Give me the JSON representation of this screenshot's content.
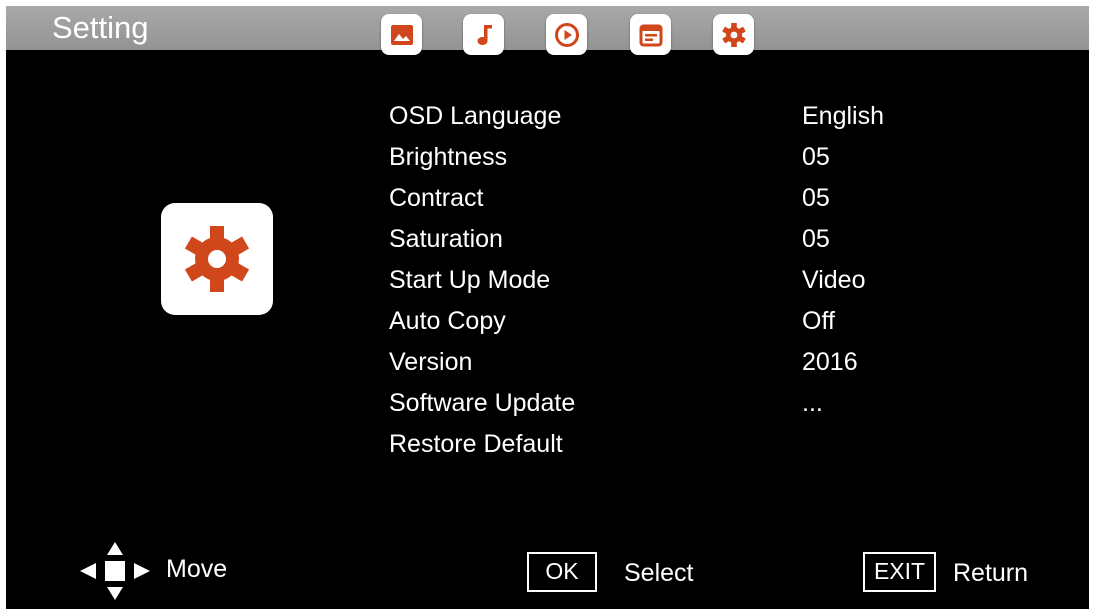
{
  "header": {
    "title": "Setting",
    "tabs": [
      {
        "icon": "photo-icon"
      },
      {
        "icon": "music-note-icon"
      },
      {
        "icon": "play-circle-icon"
      },
      {
        "icon": "calendar-icon"
      },
      {
        "icon": "gear-icon"
      }
    ]
  },
  "colors": {
    "accent": "#d0471c",
    "background": "#000000",
    "topbar": "#a0a0a0",
    "text": "#ffffff"
  },
  "settings": {
    "items": [
      {
        "label": "OSD Language",
        "value": "English"
      },
      {
        "label": "Brightness",
        "value": "05"
      },
      {
        "label": "Contract",
        "value": "05"
      },
      {
        "label": "Saturation",
        "value": "05"
      },
      {
        "label": "Start Up Mode",
        "value": "Video"
      },
      {
        "label": "Auto Copy",
        "value": "Off"
      },
      {
        "label": "Version",
        "value": "2016"
      },
      {
        "label": "Software Update",
        "value": "..."
      },
      {
        "label": "Restore Default",
        "value": ""
      }
    ]
  },
  "footer": {
    "move_label": "Move",
    "ok_key": "OK",
    "select_label": "Select",
    "exit_key": "EXIT",
    "return_label": "Return"
  }
}
